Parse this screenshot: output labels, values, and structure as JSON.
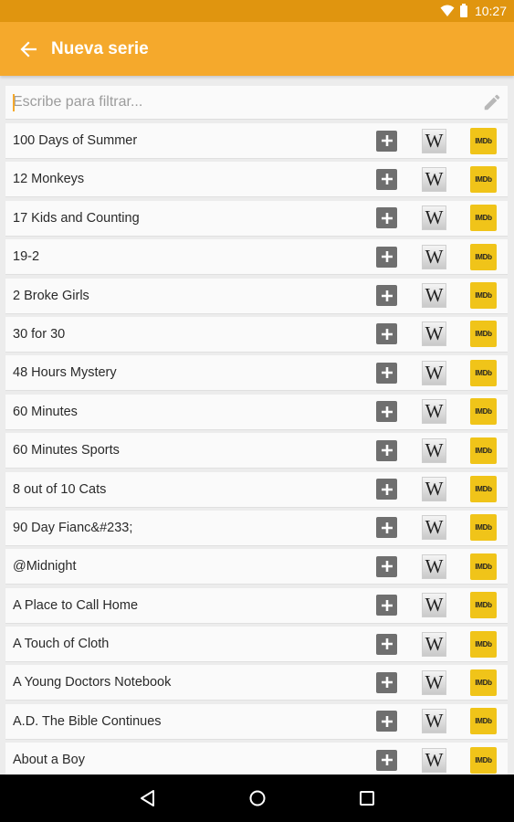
{
  "status_bar": {
    "time": "10:27",
    "icons": [
      "wifi-icon",
      "battery-icon"
    ]
  },
  "app_bar": {
    "title": "Nueva serie",
    "back_icon": "arrow-back-icon"
  },
  "search": {
    "placeholder": "Escribe para filtrar...",
    "value": "",
    "icon": "pencil-icon"
  },
  "row_actions": {
    "add_icon": "plus-icon",
    "wiki_label": "W",
    "imdb_label": "IMDb"
  },
  "shows": [
    "100 Days of Summer",
    "12 Monkeys",
    "17 Kids and Counting",
    "19-2",
    "2 Broke Girls",
    "30 for 30",
    "48 Hours Mystery",
    "60 Minutes",
    "60 Minutes Sports",
    "8 out of 10 Cats",
    "90 Day Fianc&#233;",
    "@Midnight",
    "A Place to Call Home",
    "A Touch of Cloth",
    "A Young Doctors Notebook",
    "A.D. The Bible Continues",
    "About a Boy"
  ],
  "nav_bar": {
    "buttons": [
      "back-triangle-icon",
      "home-circle-icon",
      "recents-square-icon"
    ]
  },
  "colors": {
    "app_bar": "#f5a92c",
    "status_bar": "#e0950f",
    "imdb": "#f0c419"
  }
}
